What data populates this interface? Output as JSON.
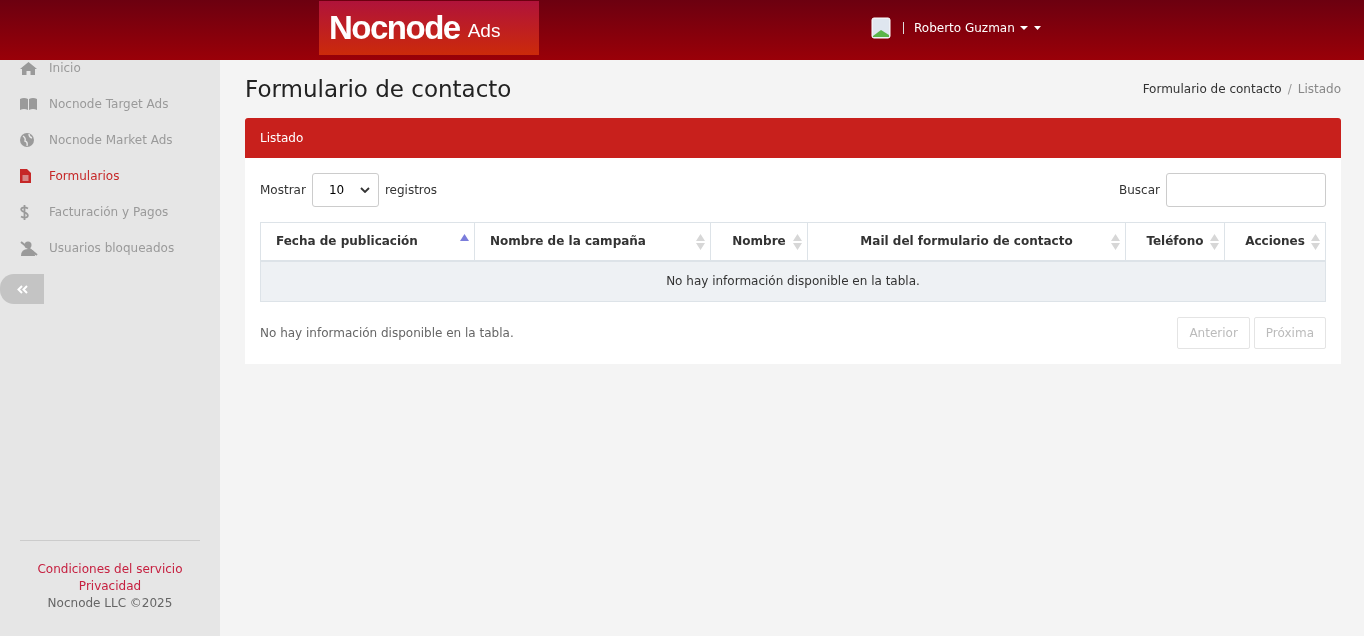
{
  "header": {
    "logo": {
      "name": "Nocnode",
      "suffix": "Ads"
    },
    "user": {
      "name": "Roberto Guzman"
    }
  },
  "sidebar": {
    "items": [
      {
        "label": "Inicio",
        "selected": false
      },
      {
        "label": "Nocnode Target Ads",
        "selected": false
      },
      {
        "label": "Nocnode Market Ads",
        "selected": false
      },
      {
        "label": "Formularios",
        "selected": true
      },
      {
        "label": "Facturación y Pagos",
        "selected": false
      },
      {
        "label": "Usuarios bloqueados",
        "selected": false
      }
    ],
    "footer": {
      "links": [
        "Condiciones del servicio",
        "Privacidad"
      ],
      "copyright": "Nocnode LLC ©2025"
    }
  },
  "page": {
    "title": "Formulario de contacto",
    "breadcrumb_separator": "/",
    "breadcrumb": [
      {
        "label": "Formulario de contacto",
        "selected": false
      },
      {
        "label": "Listado",
        "selected": true
      }
    ]
  },
  "panel": {
    "title": "Listado",
    "length": {
      "before": "Mostrar",
      "value": "10",
      "after": "registros"
    },
    "search": {
      "label": "Buscar"
    },
    "table": {
      "columns": [
        {
          "label": "Fecha de publicación",
          "sorted_ascending": true
        },
        {
          "label": "Nombre de la campaña",
          "sorted_ascending": false
        },
        {
          "label": "Nombre",
          "sorted_ascending": false
        },
        {
          "label": "Mail del formulario de contacto",
          "sorted_ascending": false
        },
        {
          "label": "Teléfono",
          "sorted_ascending": false
        },
        {
          "label": "Acciones",
          "sorted_ascending": false
        }
      ],
      "empty": "No hay información disponible en la tabla."
    },
    "info": "No hay información disponible en la tabla.",
    "pagination": [
      {
        "label": "Anterior",
        "disabled": true
      },
      {
        "label": "Próxima",
        "disabled": true
      }
    ]
  }
}
